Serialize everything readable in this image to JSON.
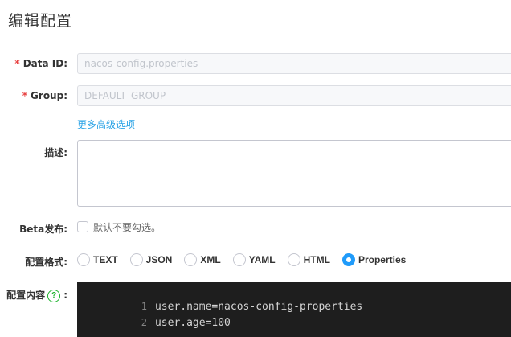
{
  "title": "编辑配置",
  "form": {
    "data_id": {
      "required_mark": "*",
      "label": "Data ID:",
      "value": "nacos-config.properties"
    },
    "group": {
      "required_mark": "*",
      "label": "Group:",
      "value": "DEFAULT_GROUP"
    },
    "more_options_link": "更多高级选项",
    "description": {
      "label": "描述:",
      "value": ""
    },
    "beta": {
      "label": "Beta发布:",
      "checked": false,
      "hint": "默认不要勾选。"
    },
    "format": {
      "label": "配置格式:",
      "options": [
        "TEXT",
        "JSON",
        "XML",
        "YAML",
        "HTML",
        "Properties"
      ],
      "selected": "Properties"
    },
    "content": {
      "label": "配置内容",
      "help_icon_text": "?",
      "colon": ":",
      "lines": [
        {
          "number": "1",
          "code": "user.name=nacos-config-properties"
        },
        {
          "number": "2",
          "code": "user.age=100"
        }
      ]
    }
  },
  "colors": {
    "required": "#e84343",
    "link": "#2aa3e6",
    "radio_selected": "#209bfa",
    "help_icon": "#1db32d",
    "editor_background": "#1e1e1e"
  },
  "icons": {
    "help": "question-circle-icon"
  }
}
